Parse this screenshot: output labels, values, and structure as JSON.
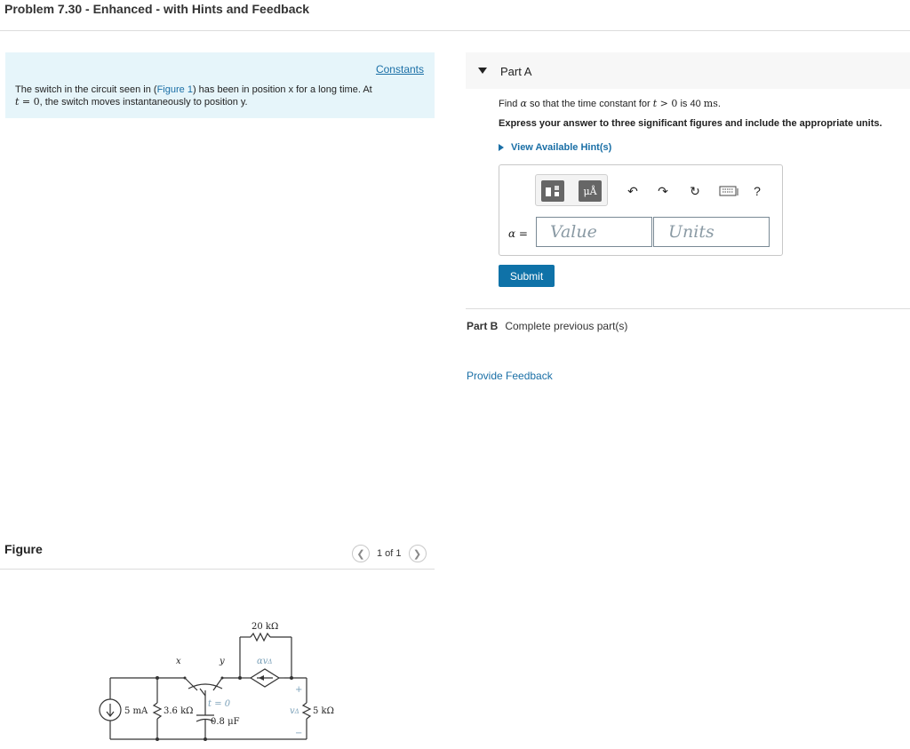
{
  "header": {
    "title": "Problem 7.30 - Enhanced - with Hints and Feedback"
  },
  "intro": {
    "constants_link": "Constants",
    "text_before_link": "The switch in the circuit seen in (",
    "figure_link": "Figure 1",
    "text_after_link": ") has been in position x for a long time. At",
    "time_var": "t",
    "time_eq": " = 0",
    "line2_rest": ", the switch moves instantaneously to position y."
  },
  "figure": {
    "label": "Figure",
    "pager": "1 of 1",
    "circuit": {
      "source": "5 mA",
      "r1": "3.6 kΩ",
      "r_top": "20 kΩ",
      "r_right": "5 kΩ",
      "cap": "0.8 μF",
      "switch_time": "t = 0",
      "pos_x": "x",
      "pos_y": "y",
      "dep_source": "αv",
      "dep_sub": "Δ",
      "v_label": "v",
      "v_sub": "Δ",
      "plus": "+",
      "minus": "−"
    }
  },
  "partA": {
    "label": "Part A",
    "prompt_start": "Find ",
    "prompt_alpha": "α",
    "prompt_mid": " so that the time constant for ",
    "prompt_t": "t",
    "prompt_gt": " > 0",
    "prompt_is": " is 40 ",
    "prompt_unit": "ms",
    "prompt_end": ".",
    "instruction": "Express your answer to three significant figures and include the appropriate units.",
    "hints": "View Available Hint(s)",
    "alpha_label": "α =",
    "value_placeholder": "Value",
    "units_placeholder": "Units",
    "units_icon_text": "μÅ",
    "help_icon": "?",
    "submit": "Submit"
  },
  "partB": {
    "label": "Part B",
    "status": "Complete previous part(s)"
  },
  "feedback": "Provide Feedback"
}
